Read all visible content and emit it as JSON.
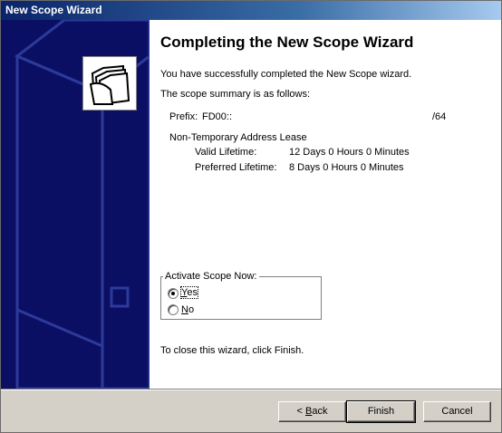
{
  "window": {
    "title": "New Scope Wizard"
  },
  "heading": "Completing the New Scope Wizard",
  "intro": "You have successfully completed the New Scope wizard.",
  "summary_intro": "The scope summary is as follows:",
  "summary": {
    "prefix_label": "Prefix:",
    "prefix_value": "FD00::",
    "prefix_length": "/64",
    "lease_type": "Non-Temporary Address Lease",
    "valid_label": "Valid Lifetime:",
    "valid_value": "12 Days 0 Hours 0 Minutes",
    "preferred_label": "Preferred Lifetime:",
    "preferred_value": "8 Days 0 Hours 0 Minutes"
  },
  "activate_group": {
    "legend": "Activate Scope Now:",
    "options": [
      {
        "label_hot": "Y",
        "label_rest": "es",
        "selected": true
      },
      {
        "label_hot": "N",
        "label_rest": "o",
        "selected": false
      }
    ]
  },
  "close_hint": "To close this wizard, click Finish.",
  "buttons": {
    "back_prefix": "< ",
    "back_hot": "B",
    "back_rest": "ack",
    "finish": "Finish",
    "cancel": "Cancel"
  },
  "icons": {
    "wizard": "folders-icon"
  }
}
